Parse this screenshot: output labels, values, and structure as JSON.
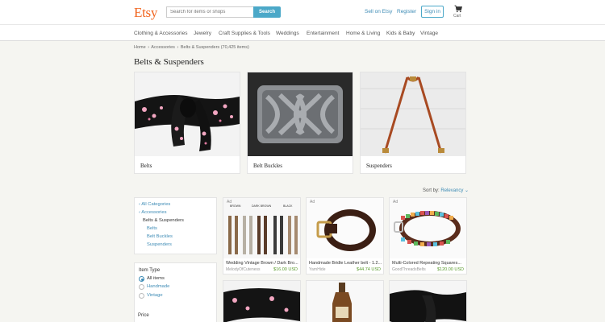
{
  "header": {
    "logo": "Etsy",
    "search_placeholder": "Search for items or shops",
    "search_button": "Search",
    "sell_link": "Sell on Etsy",
    "register_link": "Register",
    "signin_button": "Sign in",
    "cart_label": "Cart",
    "cart_icon": "cart-icon"
  },
  "categories": [
    "Clothing & Accessories",
    "Jewelry",
    "Craft Supplies & Tools",
    "Weddings",
    "Entertainment",
    "Home & Living",
    "Kids & Baby",
    "Vintage"
  ],
  "breadcrumb": {
    "home": "Home",
    "accessories": "Accessories",
    "current": "Belts & Suspenders",
    "count": "(70,425 items)",
    "sep": "›"
  },
  "page_title": "Belts & Suspenders",
  "category_cards": [
    {
      "label": "Belts"
    },
    {
      "label": "Belt Buckles"
    },
    {
      "label": "Suspenders"
    }
  ],
  "sort": {
    "label": "Sort by:",
    "value": "Relevancy",
    "icon": "chevron-down-icon"
  },
  "sidebar_nav": {
    "all_categories": "All Categories",
    "accessories": "Accessories",
    "current": "Belts & Suspenders",
    "sub": [
      "Belts",
      "Belt Buckles",
      "Suspenders"
    ]
  },
  "item_type": {
    "title": "Item Type",
    "options": [
      "All items",
      "Handmade",
      "Vintage"
    ],
    "selected": "All items"
  },
  "price_title": "Price",
  "products": [
    {
      "ad": "Ad",
      "title": "Wedding Vintage Brown / Dark Bro...",
      "shop": "MelodyOfCuteness",
      "price": "$16.00 USD",
      "img_labels": [
        "BROWN",
        "DARK BROWN",
        "BLACK"
      ]
    },
    {
      "ad": "Ad",
      "title": "Handmade Bridle Leather belt - 1.2...",
      "shop": "YarnHide",
      "price": "$44.74 USD"
    },
    {
      "ad": "Ad",
      "title": "Multi-Colored Repeating Squares...",
      "shop": "GoodThreadsBelts",
      "price": "$120.00 USD"
    },
    {
      "ad": "",
      "title": "",
      "shop": "",
      "price": ""
    },
    {
      "ad": "",
      "title": "",
      "shop": "",
      "price": ""
    },
    {
      "ad": "",
      "title": "",
      "shop": "",
      "price": ""
    }
  ],
  "colors": {
    "brand": "#f1641e",
    "link": "#3d8bb5",
    "accent": "#4ba8c8",
    "price": "#5a9b2d",
    "background": "#f5f5f1"
  }
}
